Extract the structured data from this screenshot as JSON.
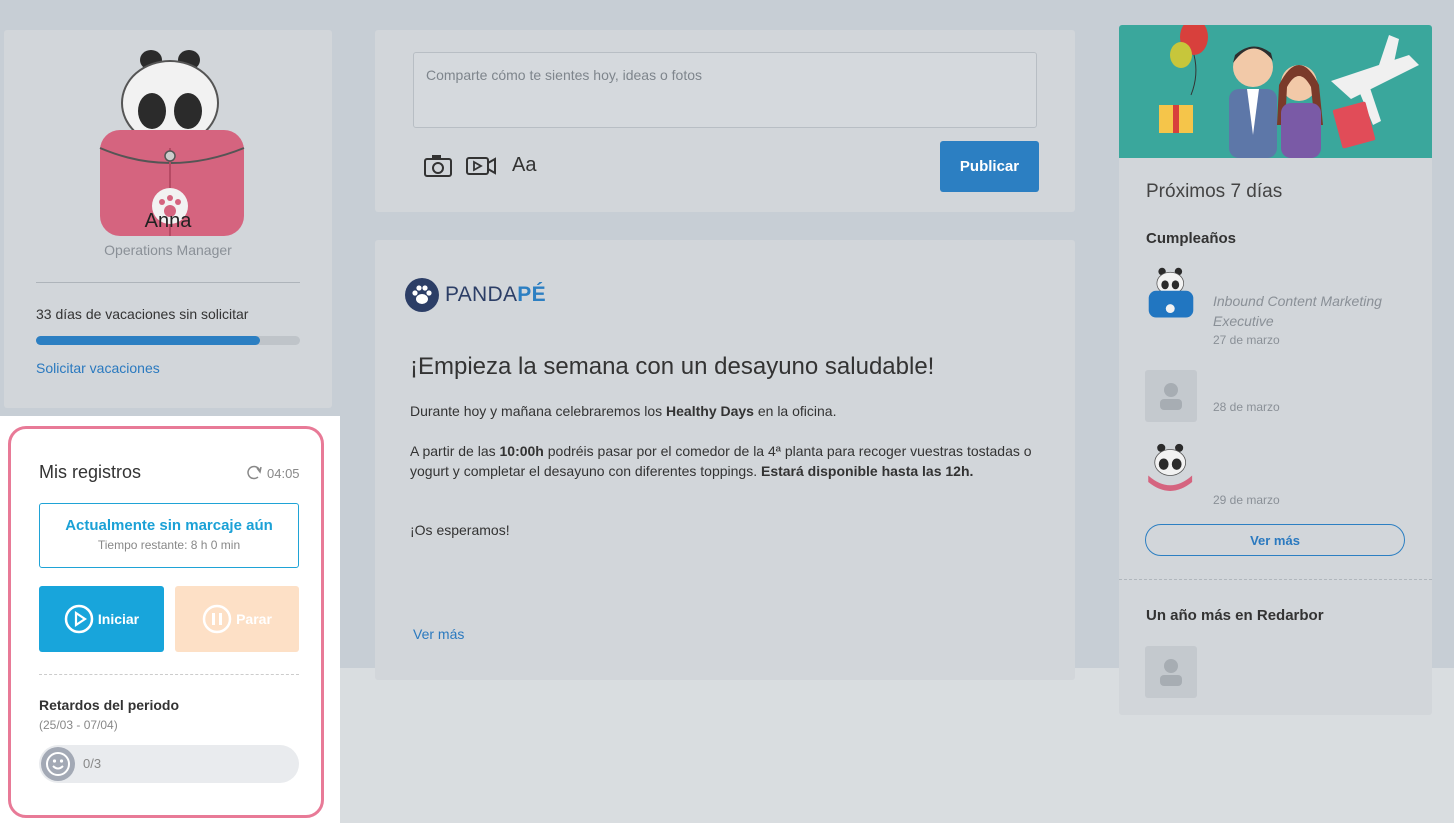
{
  "profile": {
    "name": "Anna",
    "role": "Operations Manager",
    "vacation_text": "33 días de vacaciones sin solicitar",
    "vacation_progress": 0.85,
    "vacation_link": "Solicitar vacaciones"
  },
  "compose": {
    "placeholder": "Comparte cómo te sientes hoy, ideas o fotos",
    "text_tool": "Aa",
    "publish_label": "Publicar"
  },
  "post": {
    "logo_main": "PANDA",
    "logo_accent": "PÉ",
    "title": "¡Empieza la semana con un desayuno saludable!",
    "p1_pre": "Durante hoy y mañana celebraremos los ",
    "p1_bold": "Healthy Days",
    "p1_post": " en la oficina.",
    "p2_pre": "A partir de las ",
    "p2_bold1": "10:00h",
    "p2_mid": " podréis pasar por el comedor de la 4ª planta para recoger vuestras tostadas o yogurt y completar el desayuno con diferentes toppings. ",
    "p2_bold2": "Estará disponible hasta las 12h.",
    "p3": "¡Os esperamos!",
    "more": "Ver más"
  },
  "sidebar": {
    "title": "Próximos 7 días",
    "birthdays_title": "Cumpleaños",
    "birthdays": [
      {
        "role": "Inbound Content Marketing Executive",
        "date": "27 de marzo"
      },
      {
        "role": "",
        "date": "28 de marzo"
      },
      {
        "role": "",
        "date": "29 de marzo"
      }
    ],
    "more_label": "Ver más",
    "anniversary_title": "Un año más en Redarbor"
  },
  "registros": {
    "title": "Mis registros",
    "time": "04:05",
    "status_main": "Actualmente sin marcaje aún",
    "status_sub": "Tiempo restante: 8 h 0 min",
    "start_label": "Iniciar",
    "stop_label": "Parar",
    "delays_title": "Retardos del periodo",
    "delays_range": "(25/03 - 07/04)",
    "delays_count": "0/3"
  },
  "colors": {
    "accent": "#2c7fc2",
    "cyan": "#18a5db",
    "highlight": "#e87a97",
    "stop": "#fde0c6"
  }
}
